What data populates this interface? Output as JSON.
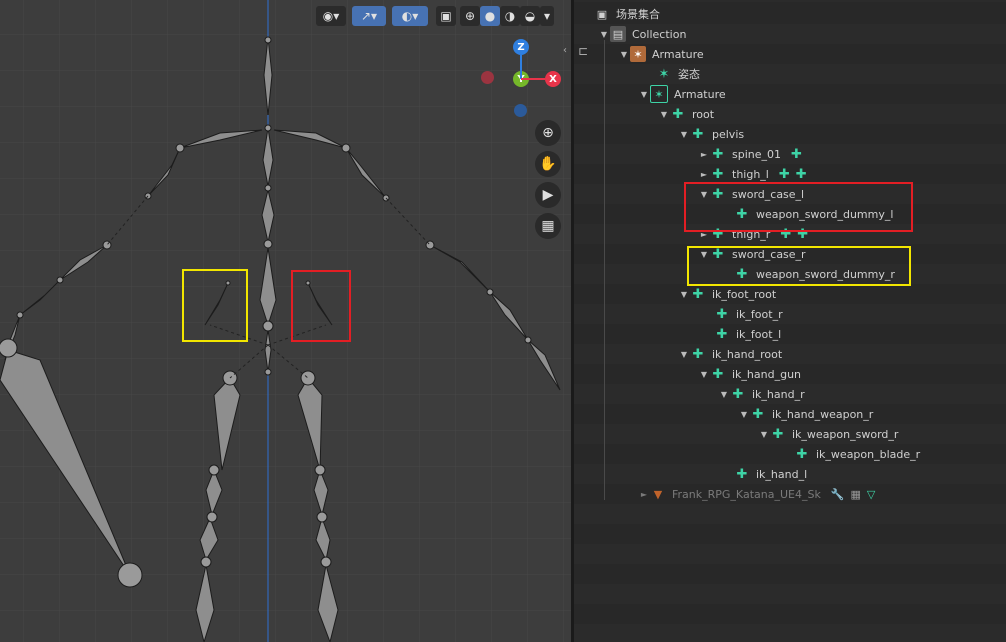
{
  "viewport": {
    "toolbar": [
      "eye-icon",
      "select-icon",
      "overlay-icon",
      "xray-icon",
      "wireframe-icon",
      "solid-icon",
      "material-icon",
      "rendered-icon"
    ],
    "gizmo": {
      "z": "Z",
      "y": "Y",
      "x": "X"
    },
    "nav": [
      "zoom-icon",
      "hand-icon",
      "camera-icon",
      "grid-icon"
    ]
  },
  "outliner": {
    "rows": [
      {
        "label": "场景集合"
      },
      {
        "label": "Collection"
      },
      {
        "label": "Armature"
      },
      {
        "label": "姿态"
      },
      {
        "label": "Armature"
      },
      {
        "label": "root"
      },
      {
        "label": "pelvis"
      },
      {
        "label": "spine_01"
      },
      {
        "label": "thigh_l"
      },
      {
        "label": "sword_case_l"
      },
      {
        "label": "weapon_sword_dummy_l"
      },
      {
        "label": "thigh_r"
      },
      {
        "label": "sword_case_r"
      },
      {
        "label": "weapon_sword_dummy_r"
      },
      {
        "label": "ik_foot_root"
      },
      {
        "label": "ik_foot_r"
      },
      {
        "label": "ik_foot_l"
      },
      {
        "label": "ik_hand_root"
      },
      {
        "label": "ik_hand_gun"
      },
      {
        "label": "ik_hand_r"
      },
      {
        "label": "ik_hand_weapon_r"
      },
      {
        "label": "ik_weapon_sword_r"
      },
      {
        "label": "ik_weapon_blade_r"
      },
      {
        "label": "ik_hand_l"
      },
      {
        "label": "Frank_RPG_Katana_UE4_Sk"
      }
    ]
  },
  "colors": {
    "highlight_red": "#e31e24",
    "highlight_yellow": "#f2e600",
    "bone": "#3ed3a6",
    "active_button": "#4772b3"
  }
}
